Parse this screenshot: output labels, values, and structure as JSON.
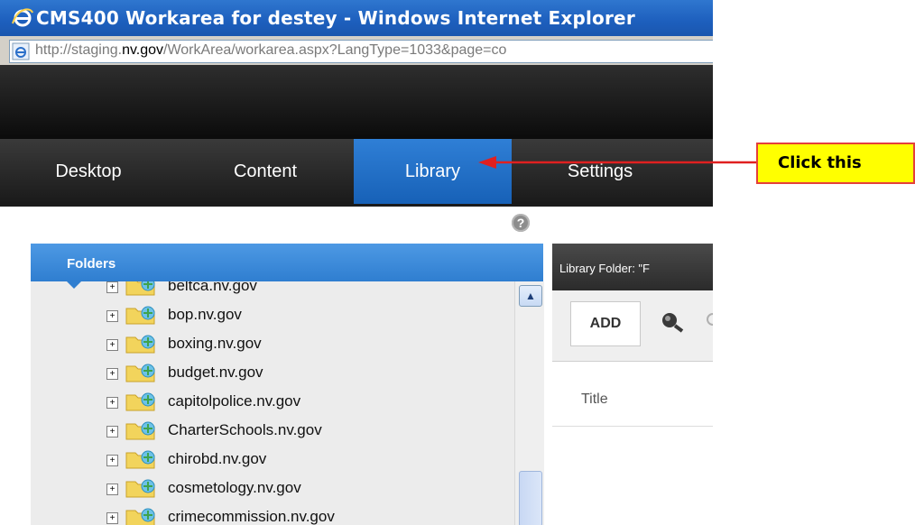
{
  "window": {
    "title": "CMS400 Workarea for destey - Windows Internet Explorer",
    "url_prefix": "http://staging.",
    "url_domain": "nv.gov",
    "url_rest": "/WorkArea/workarea.aspx?LangType=1033&page=co"
  },
  "nav": {
    "tabs": [
      {
        "label": "Desktop",
        "active": false
      },
      {
        "label": "Content",
        "active": false
      },
      {
        "label": "Library",
        "active": true
      },
      {
        "label": "Settings",
        "active": false
      }
    ]
  },
  "help": {
    "icon": "help-icon",
    "glyph": "?"
  },
  "folders": {
    "title": "Folders",
    "items": [
      {
        "label": "beltca.nv.gov"
      },
      {
        "label": "bop.nv.gov"
      },
      {
        "label": "boxing.nv.gov"
      },
      {
        "label": "budget.nv.gov"
      },
      {
        "label": "capitolpolice.nv.gov"
      },
      {
        "label": "CharterSchools.nv.gov"
      },
      {
        "label": "chirobd.nv.gov"
      },
      {
        "label": "cosmetology.nv.gov"
      },
      {
        "label": "crimecommission.nv.gov"
      }
    ]
  },
  "library": {
    "header": "Library Folder: \"F",
    "add_label": "ADD",
    "column_title": "Title"
  },
  "annotation": {
    "callout": "Click this",
    "arrow_color": "#e02020",
    "callout_bg": "#ffff00",
    "callout_border": "#e4403a"
  },
  "colors": {
    "active_tab": "#2f7fd6",
    "titlebar": "#1d5fbd",
    "folders_header": "#2f7ed0"
  }
}
